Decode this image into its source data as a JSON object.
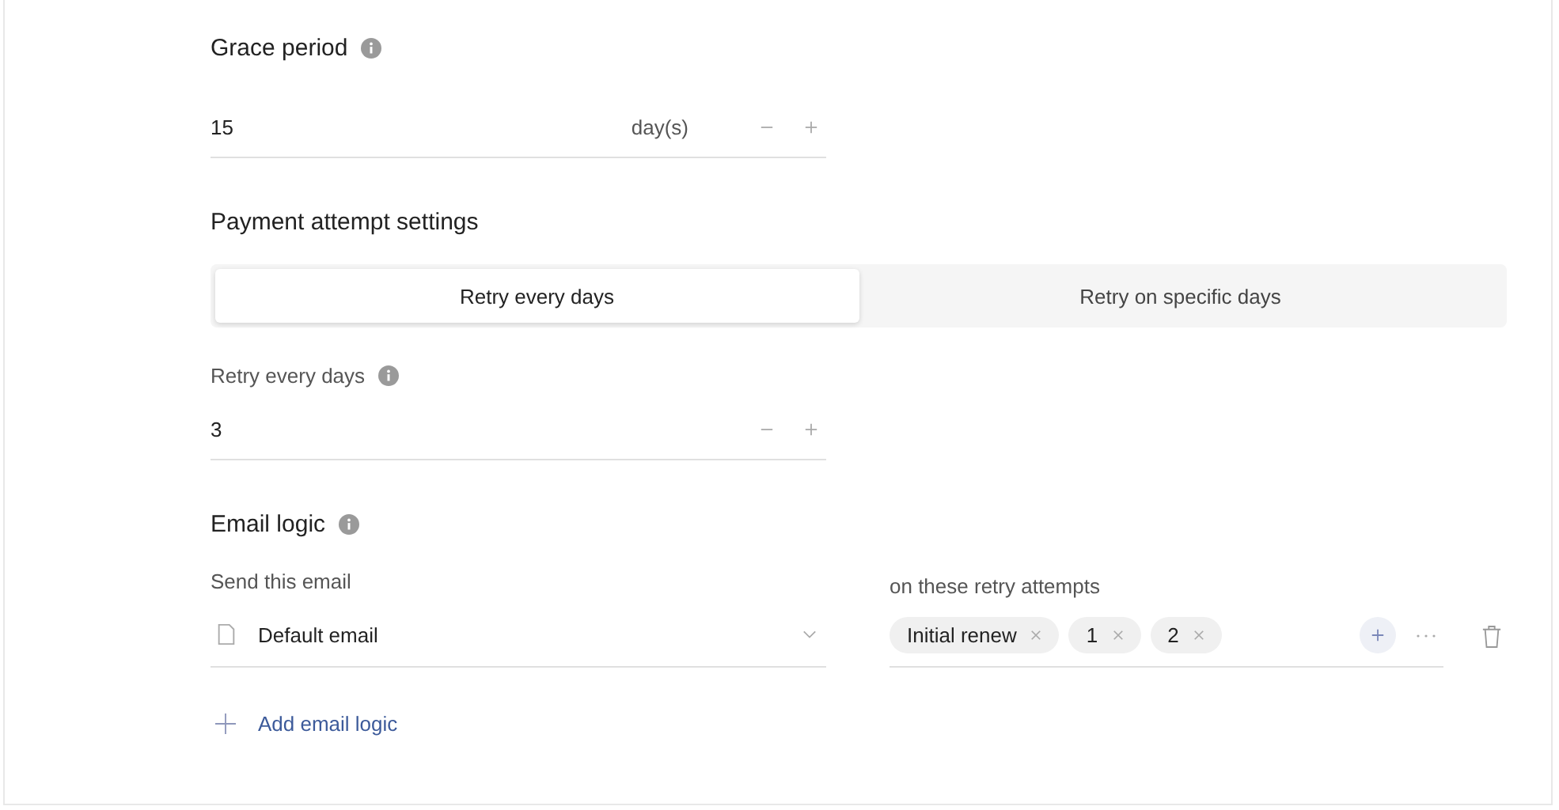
{
  "grace_period": {
    "label": "Grace period",
    "value": "15",
    "unit": "day(s)"
  },
  "payment_attempt": {
    "title": "Payment attempt settings",
    "tabs": [
      {
        "label": "Retry every days",
        "selected": true
      },
      {
        "label": "Retry on specific days",
        "selected": false
      }
    ],
    "retry_field": {
      "label": "Retry every days",
      "value": "3"
    }
  },
  "email_logic": {
    "title": "Email logic",
    "send_label": "Send this email",
    "email": "Default email",
    "attempts_label": "on these retry attempts",
    "attempts": [
      {
        "label": "Initial renew"
      },
      {
        "label": "1"
      },
      {
        "label": "2"
      }
    ],
    "add_label": "Add email logic"
  }
}
